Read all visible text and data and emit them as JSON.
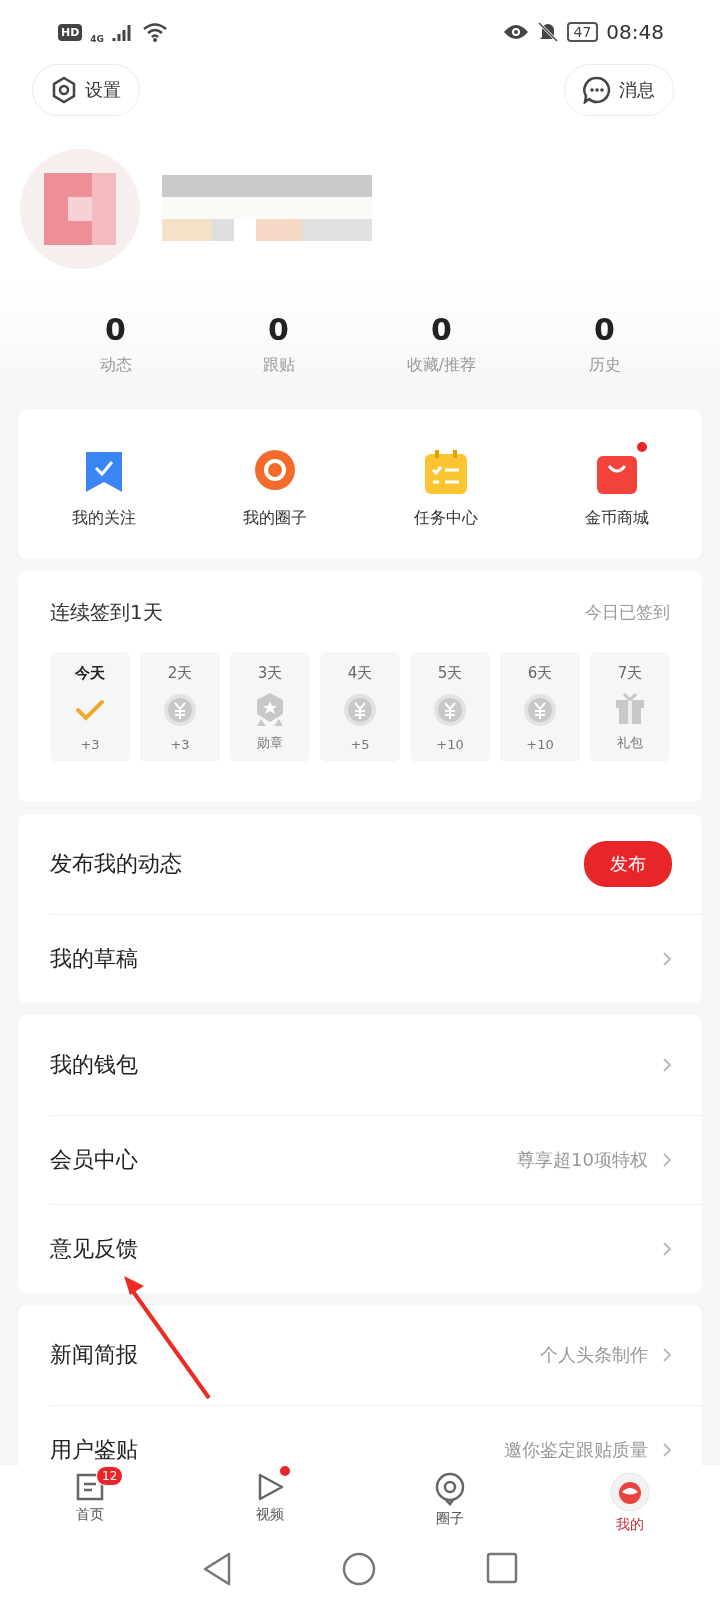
{
  "status_bar": {
    "hd": "HD",
    "network": "4G",
    "battery": "47",
    "time": "08:48"
  },
  "top_buttons": [
    {
      "label": "设置",
      "kind": "settings"
    },
    {
      "label": "消息",
      "kind": "message"
    }
  ],
  "stats": [
    {
      "value": "0",
      "label": "动态"
    },
    {
      "value": "0",
      "label": "跟贴"
    },
    {
      "value": "0",
      "label": "收藏/推荐"
    },
    {
      "value": "0",
      "label": "历史"
    }
  ],
  "shortcuts": [
    {
      "label": "我的关注",
      "kind": "follow",
      "unread": false
    },
    {
      "label": "我的圈子",
      "kind": "circle",
      "unread": false
    },
    {
      "label": "任务中心",
      "kind": "tasks",
      "unread": false
    },
    {
      "label": "金币商城",
      "kind": "mall",
      "unread": true
    }
  ],
  "checkin": {
    "title": "连续签到1天",
    "status": "今日已签到",
    "days": [
      {
        "day": "今天",
        "reward": "+3",
        "kind": "check",
        "selected": true
      },
      {
        "day": "2天",
        "reward": "+3",
        "kind": "coin",
        "selected": false
      },
      {
        "day": "3天",
        "reward": "勋章",
        "kind": "medal",
        "selected": false
      },
      {
        "day": "4天",
        "reward": "+5",
        "kind": "coin",
        "selected": false
      },
      {
        "day": "5天",
        "reward": "+10",
        "kind": "coin",
        "selected": false
      },
      {
        "day": "6天",
        "reward": "+10",
        "kind": "coin",
        "selected": false
      },
      {
        "day": "7天",
        "reward": "礼包",
        "kind": "gift",
        "selected": false
      }
    ]
  },
  "sections": [
    {
      "rows": [
        {
          "label": "发布我的动态",
          "kind": "action",
          "action": "发布"
        },
        {
          "label": "我的草稿",
          "kind": "link"
        }
      ]
    },
    {
      "rows": [
        {
          "label": "我的钱包",
          "kind": "link"
        },
        {
          "label": "会员中心",
          "kind": "link",
          "hint": "尊享超10项特权"
        },
        {
          "label": "意见反馈",
          "kind": "link"
        }
      ]
    },
    {
      "rows": [
        {
          "label": "新闻简报",
          "kind": "link",
          "hint": "个人头条制作"
        },
        {
          "label": "用户鉴贴",
          "kind": "link",
          "hint": "邀你鉴定跟贴质量"
        }
      ]
    }
  ],
  "tabs": [
    {
      "label": "首页",
      "kind": "home",
      "badge": "12",
      "dot": false,
      "selected": false
    },
    {
      "label": "视频",
      "kind": "video",
      "dot": true,
      "selected": false
    },
    {
      "label": "圈子",
      "kind": "circle",
      "dot": false,
      "selected": false
    },
    {
      "label": "我的",
      "kind": "me",
      "dot": false,
      "selected": true
    }
  ]
}
